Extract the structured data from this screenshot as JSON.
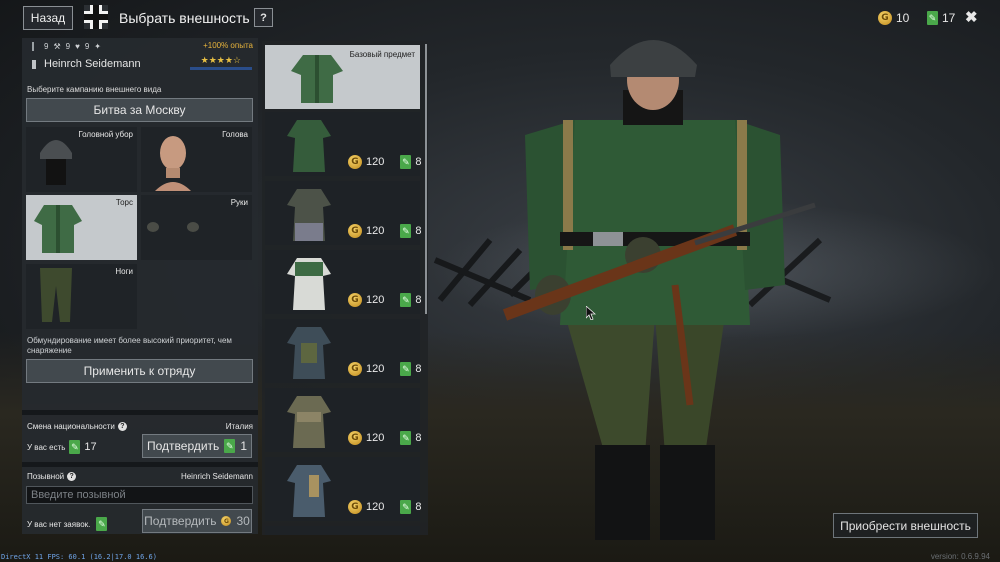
{
  "topbar": {
    "back_label": "Назад",
    "title": "Выбрать внешность",
    "help_label": "?",
    "gold": "10",
    "tickets": "17",
    "close_label": "✖"
  },
  "soldier": {
    "stats": [
      "9",
      "9",
      "9"
    ],
    "bonus": "+100% опыта",
    "name": "Heinrch Seidemann",
    "stars": "★★★★☆"
  },
  "campaign": {
    "prompt": "Выберите кампанию внешнего вида",
    "selected": "Битва за Москву"
  },
  "slots": [
    {
      "label": "Головной убор"
    },
    {
      "label": "Голова"
    },
    {
      "label": "Торс"
    },
    {
      "label": "Руки"
    },
    {
      "label": "Ноги"
    }
  ],
  "priority_note": "Обмундирование имеет более высокий приоритет, чем снаряжение",
  "apply_label": "Применить к отряду",
  "nationality": {
    "title": "Смена национальности",
    "value": "Италия",
    "have_label": "У вас есть",
    "have_count": "17",
    "confirm_label": "Подтвердить",
    "confirm_cost": "1"
  },
  "callsign": {
    "title": "Позывной",
    "value": "Heinrich Seidemann",
    "placeholder": "Введите позывной",
    "no_requests": "У вас нет заявок.",
    "confirm_label": "Подтвердить",
    "confirm_cost": "30"
  },
  "items": [
    {
      "label": "Базовый предмет",
      "price_gold": "",
      "price_tickets": ""
    },
    {
      "label": "",
      "price_gold": "120",
      "price_tickets": "8"
    },
    {
      "label": "",
      "price_gold": "120",
      "price_tickets": "8"
    },
    {
      "label": "",
      "price_gold": "120",
      "price_tickets": "8"
    },
    {
      "label": "",
      "price_gold": "120",
      "price_tickets": "8"
    },
    {
      "label": "",
      "price_gold": "120",
      "price_tickets": "8"
    },
    {
      "label": "",
      "price_gold": "120",
      "price_tickets": "8"
    }
  ],
  "buy_label": "Приобрести внешность",
  "debug": "DirectX 11 FPS: 60.1 (16.2|17.0 16.6)",
  "version": "version: 0.6.9.94",
  "colors": {
    "accent_gold": "#e8b43c",
    "ticket_green": "#4aa84a",
    "selected_bg": "#c5c9cc",
    "xp_blue": "#2a4d8a"
  },
  "icons": {
    "nation": "balkenkreuz-icon",
    "currency_gold": "gold-coin-icon",
    "currency_ticket": "ticket-icon",
    "close": "close-icon"
  }
}
